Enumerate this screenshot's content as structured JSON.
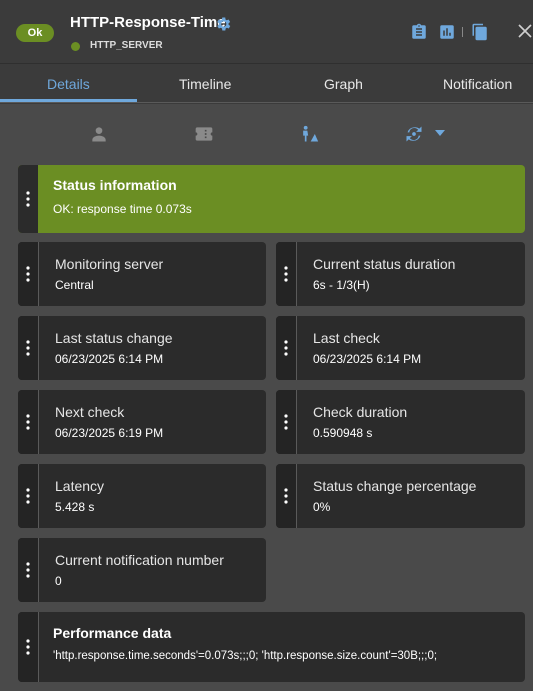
{
  "header": {
    "status": "Ok",
    "service_name": "HTTP-Response-Time",
    "host_name": "HTTP_SERVER"
  },
  "tabs": [
    {
      "label": "Details",
      "active": true
    },
    {
      "label": "Timeline",
      "active": false
    },
    {
      "label": "Graph",
      "active": false
    },
    {
      "label": "Notification",
      "active": false
    }
  ],
  "sub_icons": [
    "user-icon",
    "ticket-icon",
    "acknowledge-icon",
    "refresh-options-icon"
  ],
  "cards": {
    "status_information": {
      "label": "Status information",
      "value": "OK: response time 0.073s"
    },
    "monitoring_server": {
      "label": "Monitoring server",
      "value": "Central"
    },
    "current_status_duration": {
      "label": "Current status duration",
      "value": "6s - 1/3(H)"
    },
    "last_status_change": {
      "label": "Last status change",
      "value": "06/23/2025 6:14 PM"
    },
    "last_check": {
      "label": "Last check",
      "value": "06/23/2025 6:14 PM"
    },
    "next_check": {
      "label": "Next check",
      "value": "06/23/2025 6:19 PM"
    },
    "check_duration": {
      "label": "Check duration",
      "value": "0.590948 s"
    },
    "latency": {
      "label": "Latency",
      "value": "5.428 s"
    },
    "status_change_percentage": {
      "label": "Status change percentage",
      "value": "0%"
    },
    "current_notification_number": {
      "label": "Current notification number",
      "value": "0"
    },
    "performance_data": {
      "label": "Performance data",
      "value": "'http.response.time.seconds'=0.073s;;;0; 'http.response.size.count'=30B;;;0;"
    }
  },
  "colors": {
    "ok_green": "#6b8e23",
    "accent_blue": "#6fa8dc",
    "background": "#4a4a4a",
    "card": "#2b2b2b"
  }
}
